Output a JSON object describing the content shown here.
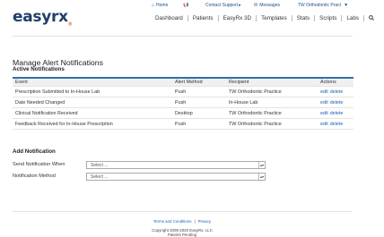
{
  "topnav": {
    "home": "Home",
    "contact_support": "Contact Support",
    "messages": "Messages",
    "practice": "TW Orthodontic Pract"
  },
  "logo": {
    "brand": "easyrx",
    "registered": "®"
  },
  "mainnav": {
    "items": [
      "Dashboard",
      "Patients",
      "EasyRx 3D",
      "Templates",
      "Stats",
      "Scripts",
      "Labs"
    ]
  },
  "page": {
    "title": "Manage Alert Notifications",
    "active_section": "Active Notifications",
    "add_section": "Add Notification"
  },
  "table": {
    "headers": [
      "Event",
      "Alert Method",
      "Recipient",
      "Actions"
    ],
    "rows": [
      {
        "event": "Prescription Submitted to In-House Lab",
        "method": "Push",
        "recipient": "TW Orthodontic Practice",
        "edit": "edit",
        "delete": "delete"
      },
      {
        "event": "Date Needed Changed",
        "method": "Push",
        "recipient": "In-House Lab",
        "edit": "edit",
        "delete": "delete"
      },
      {
        "event": "Clinical Notification Received",
        "method": "Desktop",
        "recipient": "TW Orthodontic Practice",
        "edit": "edit",
        "delete": "delete"
      },
      {
        "event": "Feedback Received for In-House Prescription",
        "method": "Push",
        "recipient": "TW Orthodontic Practice",
        "edit": "edit",
        "delete": "delete"
      }
    ]
  },
  "form": {
    "send_label": "Send Notification When",
    "send_value": "Select ...",
    "method_label": "Notification Method",
    "method_value": "Select ..."
  },
  "footer": {
    "terms": "Terms and Conditions",
    "privacy": "Privacy",
    "copyright": "Copyright 2009-2020 EasyRx, LLC",
    "patents": "Patents Pending"
  },
  "colors": {
    "brand": "#1f3e6b",
    "accent": "#2f6db0",
    "link": "#1a5fb4"
  }
}
